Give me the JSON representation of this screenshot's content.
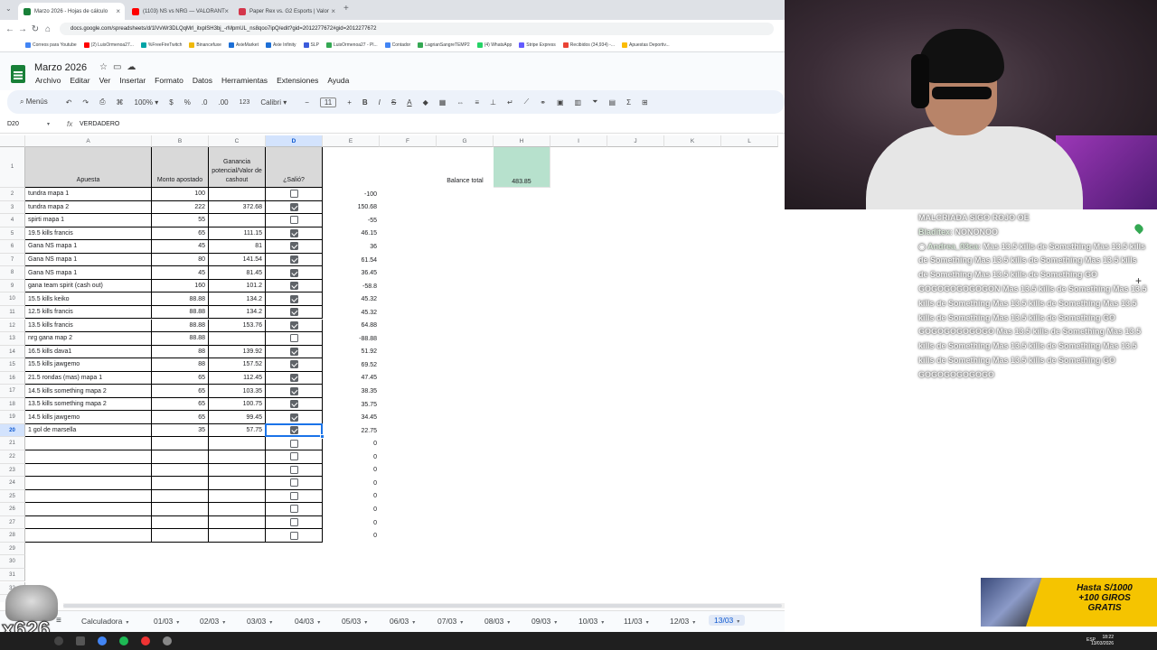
{
  "browser": {
    "tabs": [
      {
        "title": "Marzo 2026 - Hojas de cálculo",
        "color": "#188038",
        "active": true
      },
      {
        "title": "(1103) NS vs NRG — VALORANT",
        "color": "#ff0000",
        "active": false
      },
      {
        "title": "Paper Rex vs. G2 Esports | Valor",
        "color": "#d4364b",
        "active": false
      }
    ],
    "new_tab": "+",
    "url": "docs.google.com/spreadsheets/d/1lVvWr3DLQqMrl_itxplSH3bj_-rMpmUL_ns8qoo7ipQ/edit?gid=2012277672#gid=2012277672",
    "bookmarks": [
      "Correos para Youtube",
      "(2) LuisOrmenoa27...",
      "%FreeFireTwitch",
      "Binancefuxe",
      "AxieMarket",
      "Axie Infinity",
      "SLP",
      "LuisOrmenoa27 - Pl...",
      "Contador",
      "LagrianSangreTEMP2",
      "(4) WhatsApp",
      "Stripe Express",
      "Recibidos (34,934) -...",
      "Apuestas Deportiv..."
    ]
  },
  "doc": {
    "title": "Marzo 2026",
    "menu": [
      "Archivo",
      "Editar",
      "Ver",
      "Insertar",
      "Formato",
      "Datos",
      "Herramientas",
      "Extensiones",
      "Ayuda"
    ]
  },
  "toolbar": {
    "search": "Menús",
    "zoom": "100%",
    "currency": "$",
    "percent": "%",
    "dec_less": ".0",
    "dec_more": ".00",
    "format": "123",
    "font": "Calibri",
    "font_size": "11"
  },
  "formula_bar": {
    "cell_ref": "D20",
    "fx": "fx",
    "value": "VERDADERO"
  },
  "grid": {
    "columns": [
      "A",
      "B",
      "C",
      "D",
      "E",
      "F",
      "G",
      "H",
      "I",
      "J",
      "K",
      "L"
    ],
    "selected_column": "D",
    "selected_row": "20",
    "header": {
      "apuesta": "Apuesta",
      "monto": "Monto apostado",
      "ganancia": "Ganancia potencial/Valor de cashout",
      "salio": "¿Salió?"
    },
    "balance_label": "Balance total",
    "balance_value": "483.85",
    "balance_color": "#b7e1cd",
    "rows": [
      {
        "n": "2",
        "a": "tundra mapa 1",
        "b": "100",
        "c": "",
        "d": false,
        "e": "-100"
      },
      {
        "n": "3",
        "a": "tundra mapa 2",
        "b": "222",
        "c": "372.68",
        "d": true,
        "e": "150.68"
      },
      {
        "n": "4",
        "a": "spirti mapa 1",
        "b": "55",
        "c": "",
        "d": false,
        "e": "-55"
      },
      {
        "n": "5",
        "a": "19.5 kills francis",
        "b": "65",
        "c": "111.15",
        "d": true,
        "e": "46.15"
      },
      {
        "n": "6",
        "a": "Gana NS mapa 1",
        "b": "45",
        "c": "81",
        "d": true,
        "e": "36"
      },
      {
        "n": "7",
        "a": "Gana NS mapa 1",
        "b": "80",
        "c": "141.54",
        "d": true,
        "e": "61.54"
      },
      {
        "n": "8",
        "a": "Gana NS mapa 1",
        "b": "45",
        "c": "81.45",
        "d": true,
        "e": "36.45"
      },
      {
        "n": "9",
        "a": "gana team spirit (cash out)",
        "b": "160",
        "c": "101.2",
        "d": true,
        "e": "-58.8"
      },
      {
        "n": "10",
        "a": "15.5 kills keiko",
        "b": "88.88",
        "c": "134.2",
        "d": true,
        "e": "45.32"
      },
      {
        "n": "11",
        "a": "12.5 kills francis",
        "b": "88.88",
        "c": "134.2",
        "d": true,
        "e": "45.32"
      },
      {
        "n": "12",
        "a": "13.5 kills francis",
        "b": "88.88",
        "c": "153.76",
        "d": true,
        "e": "64.88"
      },
      {
        "n": "13",
        "a": "nrg gana map 2",
        "b": "88.88",
        "c": "",
        "d": false,
        "e": "-88.88"
      },
      {
        "n": "14",
        "a": "16.5 kills dava1",
        "b": "88",
        "c": "139.92",
        "d": true,
        "e": "51.92"
      },
      {
        "n": "15",
        "a": "15.5 kills jawgemo",
        "b": "88",
        "c": "157.52",
        "d": true,
        "e": "69.52"
      },
      {
        "n": "16",
        "a": "21.5 rondas (mas) mapa 1",
        "b": "65",
        "c": "112.45",
        "d": true,
        "e": "47.45"
      },
      {
        "n": "17",
        "a": "14.5 kills something mapa 2",
        "b": "65",
        "c": "103.35",
        "d": true,
        "e": "38.35"
      },
      {
        "n": "18",
        "a": "13.5 kills something mapa 2",
        "b": "65",
        "c": "100.75",
        "d": true,
        "e": "35.75"
      },
      {
        "n": "19",
        "a": "14.5 kills jawgemo",
        "b": "65",
        "c": "99.45",
        "d": true,
        "e": "34.45"
      },
      {
        "n": "20",
        "a": "1 gol de marsella",
        "b": "35",
        "c": "57.75",
        "d": true,
        "e": "22.75"
      },
      {
        "n": "21",
        "a": "",
        "b": "",
        "c": "",
        "d": false,
        "e": "0"
      },
      {
        "n": "22",
        "a": "",
        "b": "",
        "c": "",
        "d": false,
        "e": "0"
      },
      {
        "n": "23",
        "a": "",
        "b": "",
        "c": "",
        "d": false,
        "e": "0"
      },
      {
        "n": "24",
        "a": "",
        "b": "",
        "c": "",
        "d": false,
        "e": "0"
      },
      {
        "n": "25",
        "a": "",
        "b": "",
        "c": "",
        "d": false,
        "e": "0"
      },
      {
        "n": "26",
        "a": "",
        "b": "",
        "c": "",
        "d": false,
        "e": "0"
      },
      {
        "n": "27",
        "a": "",
        "b": "",
        "c": "",
        "d": false,
        "e": "0"
      },
      {
        "n": "28",
        "a": "",
        "b": "",
        "c": "",
        "d": false,
        "e": "0"
      }
    ],
    "extra_rows": [
      "29",
      "30",
      "31",
      "32",
      "33"
    ]
  },
  "sheet_tabs": [
    "Calculadora",
    "01/03",
    "02/03",
    "03/03",
    "04/03",
    "05/03",
    "06/03",
    "07/03",
    "08/03",
    "09/03",
    "10/03",
    "11/03",
    "12/03",
    "13/03"
  ],
  "active_sheet": "13/03",
  "chat": {
    "lines": [
      {
        "user": "",
        "text": "MALCRIADA SIGO ROJO OE"
      },
      {
        "user": "Bladitex",
        "text": ": NONONOO"
      },
      {
        "user": "Andrea_03ca",
        "text": ": Mas 13.5 kills de Something Mas 13.5 kills de Something Mas 13.5 kills de Something Mas 13.5 kills de Something Mas 13.5 kills de Something GO GOGOGOGOGOGON Mas 13.5 kills de Something Mas 13.5 kills de Something Mas 13.5 kills de Something Mas 13.5 kills de Something Mas 13.5 kills de Something GO GOGOGOGOGOGO Mas 13.5 kills de Something Mas 13.5 kills de Something Mas 13.5 kills de Something Mas 13.5 kills de Something Mas 13.5 kills de Something GO GOGOGOGOGOGO"
      }
    ]
  },
  "promo": {
    "line1": "Hasta S/1000",
    "line2": "+100 GIROS",
    "line3": "GRATIS"
  },
  "overlay_counter": "x626",
  "taskbar": {
    "lang": "ESP",
    "time": "18:22",
    "date": "13/03/2026"
  }
}
